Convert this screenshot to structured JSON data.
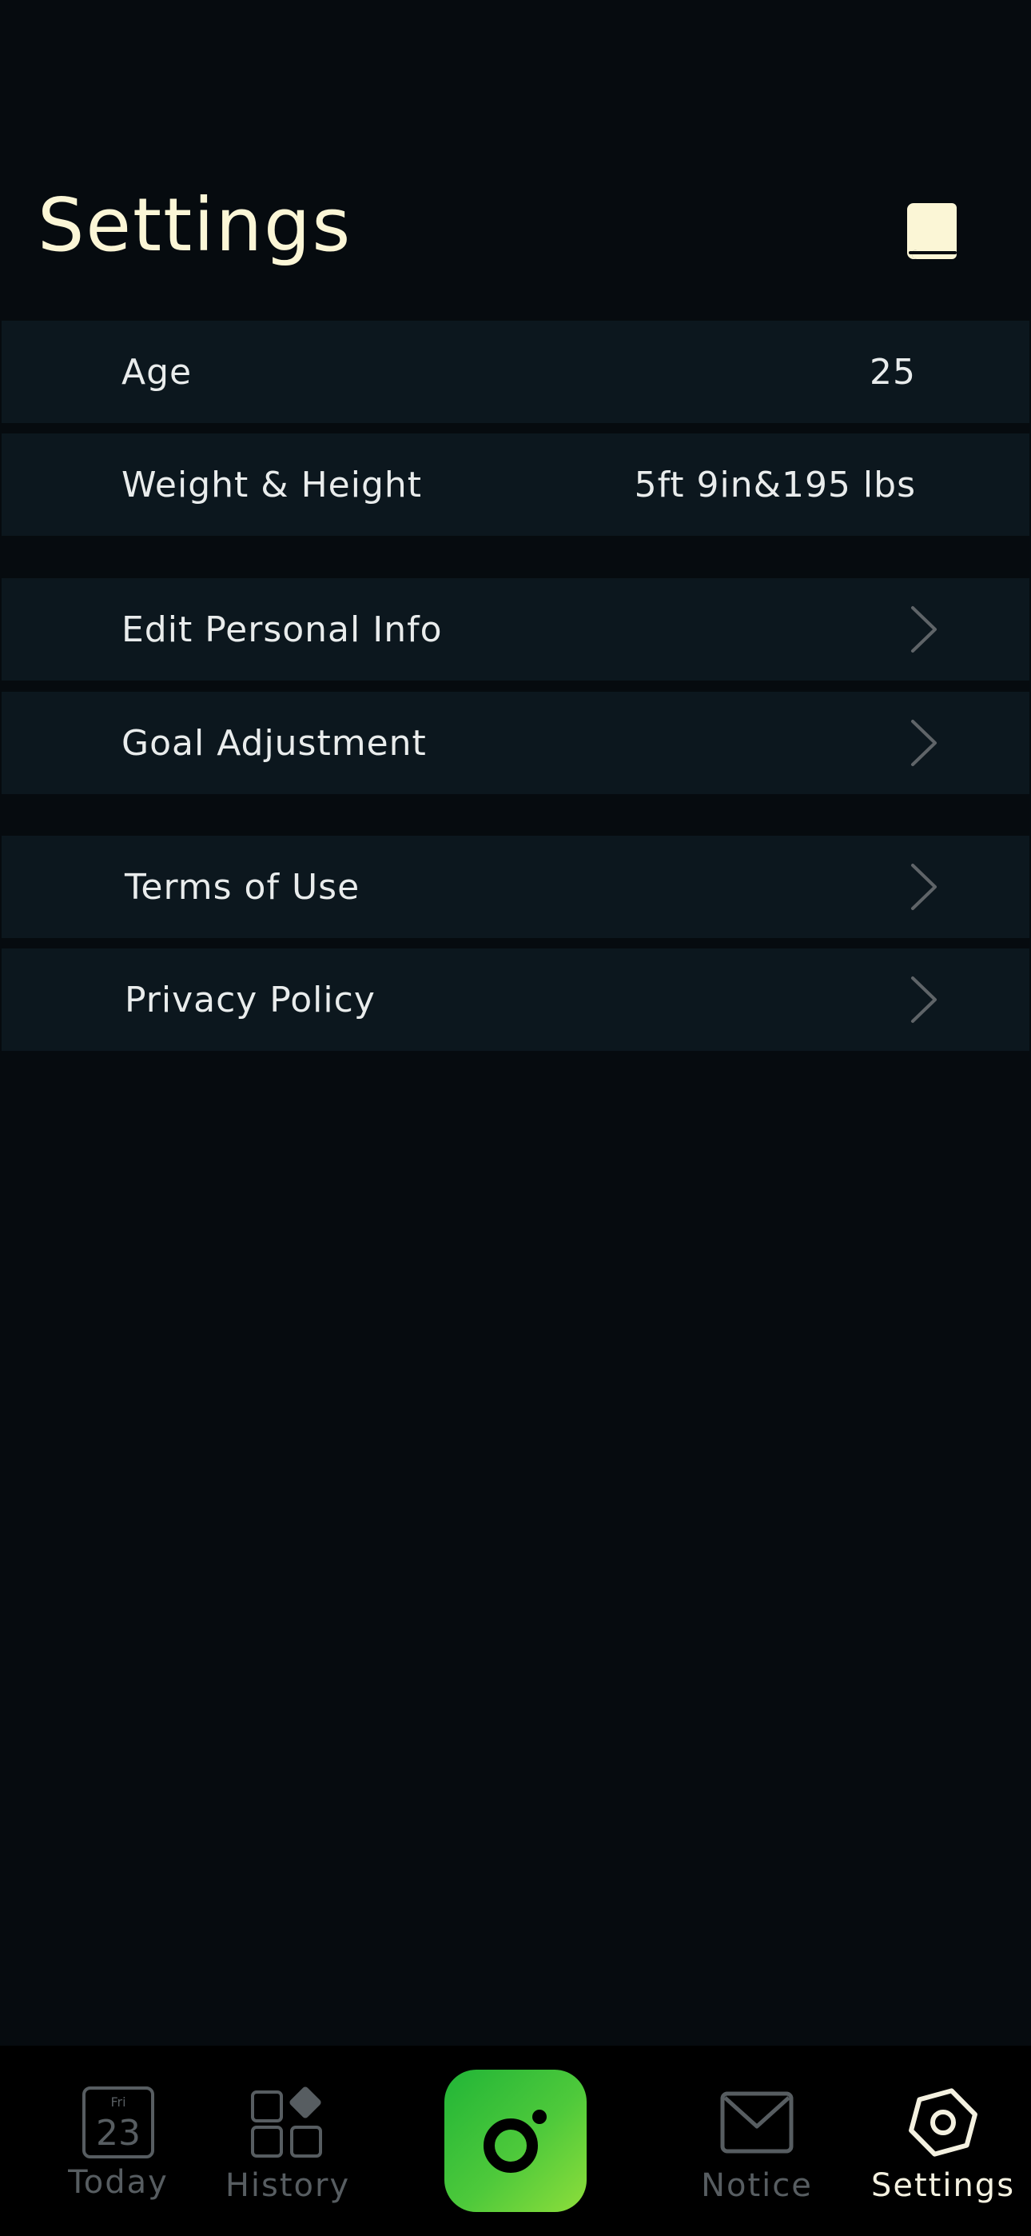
{
  "header": {
    "title": "Settings",
    "action_icon": "book-icon"
  },
  "groups": [
    {
      "rows": [
        {
          "label": "Age",
          "value": "25"
        },
        {
          "label": "Weight & Height",
          "value": "5ft 9in&195 lbs"
        }
      ]
    },
    {
      "rows": [
        {
          "label": "Edit Personal Info",
          "icon": "chevron-right-icon"
        },
        {
          "label": "Goal Adjustment",
          "icon": "chevron-right-icon"
        }
      ]
    },
    {
      "rows": [
        {
          "label": "Terms of Use",
          "icon": "chevron-right-icon"
        },
        {
          "label": "Privacy Policy",
          "icon": "chevron-right-icon"
        }
      ]
    }
  ],
  "tabbar": {
    "active_tab": "Settings",
    "today": {
      "day": "Fri",
      "date": "23",
      "label": "Today"
    },
    "history": {
      "label": "History"
    },
    "camera": {
      "icon": "camera-icon"
    },
    "notice": {
      "label": "Notice"
    },
    "settings": {
      "label": "Settings"
    }
  },
  "colors": {
    "background": "#060b0f",
    "row_background": "#0c171e",
    "title": "#fbf6d6",
    "tab_inactive": "#575d61",
    "tab_active": "#f4f1e0",
    "accent_start": "#21b537",
    "accent_end": "#8ede3b"
  }
}
